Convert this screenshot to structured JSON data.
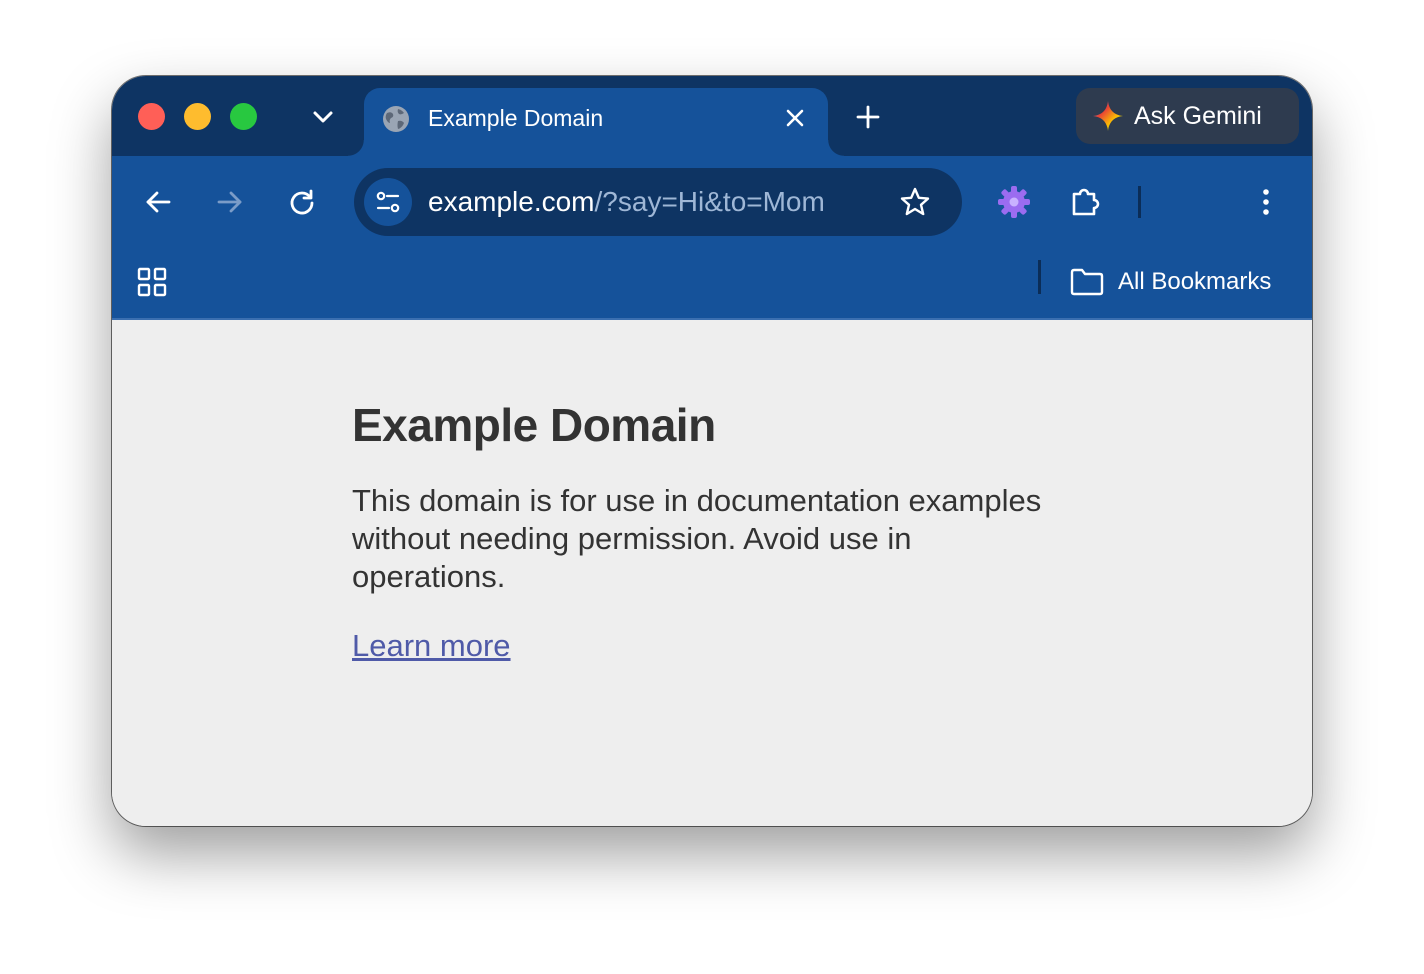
{
  "tab": {
    "title": "Example Domain",
    "favicon": "globe-icon"
  },
  "gemini": {
    "label": "Ask Gemini",
    "icon": "gemini-sparkle-icon"
  },
  "omnibox": {
    "url_host": "example.com",
    "url_path": "/?say=Hi&to=Mom"
  },
  "bookmarks_bar": {
    "folder_label": "All Bookmarks"
  },
  "page": {
    "heading": "Example Domain",
    "body": "This domain is for use in documentation examples without needing permission. Avoid use in operations.",
    "link": "Learn more"
  },
  "colors": {
    "tab_strip": "#0e3463",
    "toolbar": "#15529a",
    "page_background": "#eeeeee",
    "link": "#4f5aa8",
    "extension_accent": "#9b6cf0"
  }
}
